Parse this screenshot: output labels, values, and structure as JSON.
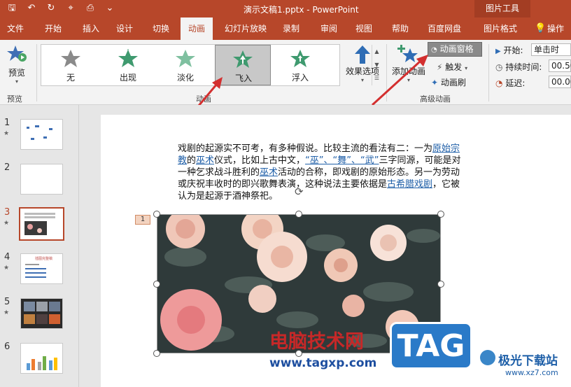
{
  "titlebar": {
    "title": "演示文稿1.pptx  -  PowerPoint",
    "context_tools": "图片工具",
    "bg": "#b7472a"
  },
  "tabs": [
    {
      "label": "文件"
    },
    {
      "label": "开始"
    },
    {
      "label": "插入"
    },
    {
      "label": "设计"
    },
    {
      "label": "切换"
    },
    {
      "label": "动画"
    },
    {
      "label": "幻灯片放映"
    },
    {
      "label": "录制"
    },
    {
      "label": "审阅"
    },
    {
      "label": "视图"
    },
    {
      "label": "帮助"
    },
    {
      "label": "百度网盘"
    },
    {
      "label": "图片格式"
    },
    {
      "label": "操作"
    }
  ],
  "ribbon": {
    "preview": {
      "label": "预览",
      "group": "预览"
    },
    "gallery": [
      {
        "label": "无",
        "icon": "star-gray-icon"
      },
      {
        "label": "出现",
        "icon": "star-burst-icon"
      },
      {
        "label": "淡化",
        "icon": "star-fade-icon"
      },
      {
        "label": "飞入",
        "icon": "star-fly-icon",
        "selected": true
      },
      {
        "label": "浮入",
        "icon": "star-float-icon"
      }
    ],
    "effect_options": "效果选项",
    "animation_group": "动画",
    "add_animation": "添加动画",
    "animation_pane": "动画窗格",
    "trigger": "触发",
    "animation_painter": "动画刷",
    "advanced_group": "高级动画",
    "start_label": "开始:",
    "start_value": "单击时",
    "duration_label": "持续时间:",
    "duration_value": "00.50",
    "delay_label": "延迟:",
    "delay_value": "00.00"
  },
  "thumbnails": [
    {
      "num": "1",
      "star": "★"
    },
    {
      "num": "2",
      "star": ""
    },
    {
      "num": "3",
      "star": "★"
    },
    {
      "num": "4",
      "star": "★",
      "title": "插图完整稿"
    },
    {
      "num": "5",
      "star": "★"
    },
    {
      "num": "6",
      "star": ""
    }
  ],
  "slide": {
    "text_part1": "戏剧的起源实不可考，有多种假说。比较主流的看法有二：一为",
    "link1": "原始宗教",
    "text_part2": "的",
    "link2": "巫术",
    "text_part3": "仪式，比如上古中文，",
    "link3": "“巫”、“舞”、“武”",
    "text_part4": "三字同源，可能是对一种乞求战斗胜利的",
    "link4": "巫术",
    "text_part5": "活动的合称，即戏剧的原始形态。另一为劳动或庆祝丰收时的即兴歌舞表演，这种说法主要依据是",
    "link5": "古希腊戏剧",
    "text_part6": "，它被认为是起源于酒神祭祀。",
    "anim_tag": "1"
  },
  "watermarks": {
    "site_cn": "电脑技术网",
    "site_url": "www.tagxp.com",
    "tag": "TAG",
    "brand": "极光下载站",
    "brand_url": "www.xz7.com"
  },
  "colors": {
    "accent": "#b7472a",
    "arrow": "#d32f2f",
    "link": "#1f5fa8"
  }
}
